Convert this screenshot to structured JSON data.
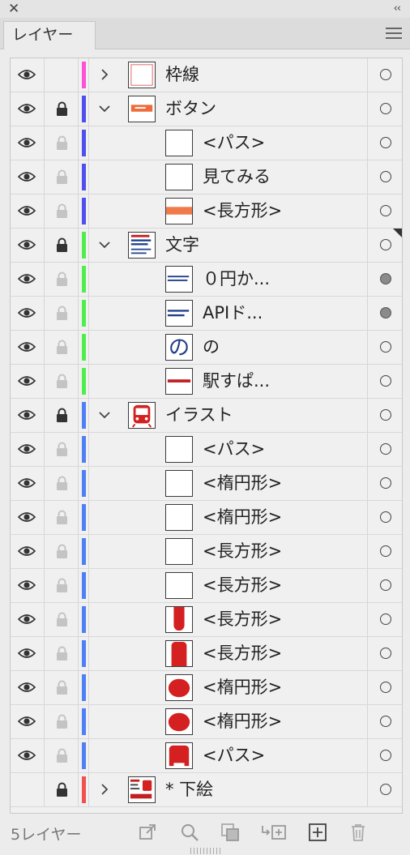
{
  "panel": {
    "close_symbol": "✕",
    "collapse_symbol": "‹‹",
    "tab_label": "レイヤー",
    "footer_count": "5レイヤー"
  },
  "colors": {
    "pink": "#ff4fd8",
    "blue": "#4f4ff0",
    "green": "#4fee4f",
    "lightblue": "#4f7ff5",
    "red": "#f24f4f"
  },
  "rows": [
    {
      "name": "枠線",
      "level": 0,
      "chevron": "right",
      "lock": "locked-none",
      "color": "pink",
      "thumb": "frame",
      "target": "empty"
    },
    {
      "name": "ボタン",
      "level": 0,
      "chevron": "down",
      "lock": "locked",
      "color": "blue",
      "thumb": "button",
      "target": "empty"
    },
    {
      "name": "<パス>",
      "level": 1,
      "chevron": "",
      "lock": "unlocked",
      "color": "blue",
      "thumb": "blank",
      "target": "empty"
    },
    {
      "name": "見てみる",
      "level": 1,
      "chevron": "",
      "lock": "unlocked",
      "color": "blue",
      "thumb": "blank",
      "target": "empty"
    },
    {
      "name": "<長方形>",
      "level": 1,
      "chevron": "",
      "lock": "unlocked",
      "color": "blue",
      "thumb": "orange-bar",
      "target": "empty"
    },
    {
      "name": "文字",
      "level": 0,
      "chevron": "down",
      "lock": "locked",
      "color": "green",
      "thumb": "text-block",
      "target": "empty",
      "corner": true
    },
    {
      "name": "０円か...",
      "level": 1,
      "chevron": "",
      "lock": "unlocked",
      "color": "green",
      "thumb": "text-small",
      "target": "filled"
    },
    {
      "name": "APIド...",
      "level": 1,
      "chevron": "",
      "lock": "unlocked",
      "color": "green",
      "thumb": "text-small2",
      "target": "filled"
    },
    {
      "name": "の",
      "level": 1,
      "chevron": "",
      "lock": "unlocked",
      "color": "green",
      "thumb": "no-char",
      "target": "empty"
    },
    {
      "name": "駅すぱ...",
      "level": 1,
      "chevron": "",
      "lock": "unlocked",
      "color": "green",
      "thumb": "red-text",
      "target": "empty"
    },
    {
      "name": "イラスト",
      "level": 0,
      "chevron": "down",
      "lock": "locked",
      "color": "lightblue",
      "thumb": "train",
      "target": "empty"
    },
    {
      "name": "<パス>",
      "level": 1,
      "chevron": "",
      "lock": "unlocked",
      "color": "lightblue",
      "thumb": "blank",
      "target": "empty"
    },
    {
      "name": "<楕円形>",
      "level": 1,
      "chevron": "",
      "lock": "unlocked",
      "color": "lightblue",
      "thumb": "blank",
      "target": "empty"
    },
    {
      "name": "<楕円形>",
      "level": 1,
      "chevron": "",
      "lock": "unlocked",
      "color": "lightblue",
      "thumb": "blank",
      "target": "empty"
    },
    {
      "name": "<長方形>",
      "level": 1,
      "chevron": "",
      "lock": "unlocked",
      "color": "lightblue",
      "thumb": "blank",
      "target": "empty"
    },
    {
      "name": "<長方形>",
      "level": 1,
      "chevron": "",
      "lock": "unlocked",
      "color": "lightblue",
      "thumb": "blank",
      "target": "empty"
    },
    {
      "name": "<長方形>",
      "level": 1,
      "chevron": "",
      "lock": "unlocked",
      "color": "lightblue",
      "thumb": "red-pill",
      "target": "empty"
    },
    {
      "name": "<長方形>",
      "level": 1,
      "chevron": "",
      "lock": "unlocked",
      "color": "lightblue",
      "thumb": "red-rect",
      "target": "empty"
    },
    {
      "name": "<楕円形>",
      "level": 1,
      "chevron": "",
      "lock": "unlocked",
      "color": "lightblue",
      "thumb": "red-ellipse",
      "target": "empty"
    },
    {
      "name": "<楕円形>",
      "level": 1,
      "chevron": "",
      "lock": "unlocked",
      "color": "lightblue",
      "thumb": "red-ellipse",
      "target": "empty"
    },
    {
      "name": "<パス>",
      "level": 1,
      "chevron": "",
      "lock": "unlocked",
      "color": "lightblue",
      "thumb": "red-shape",
      "target": "empty"
    },
    {
      "name": "* 下絵",
      "level": 0,
      "chevron": "right",
      "lock": "locked-only",
      "color": "red",
      "thumb": "sketch",
      "target": "empty",
      "hidden": true
    }
  ],
  "footer_icons": [
    "export-icon",
    "search-icon",
    "clip-mask-icon",
    "move-to-layer-icon",
    "new-layer-icon",
    "trash-icon"
  ]
}
